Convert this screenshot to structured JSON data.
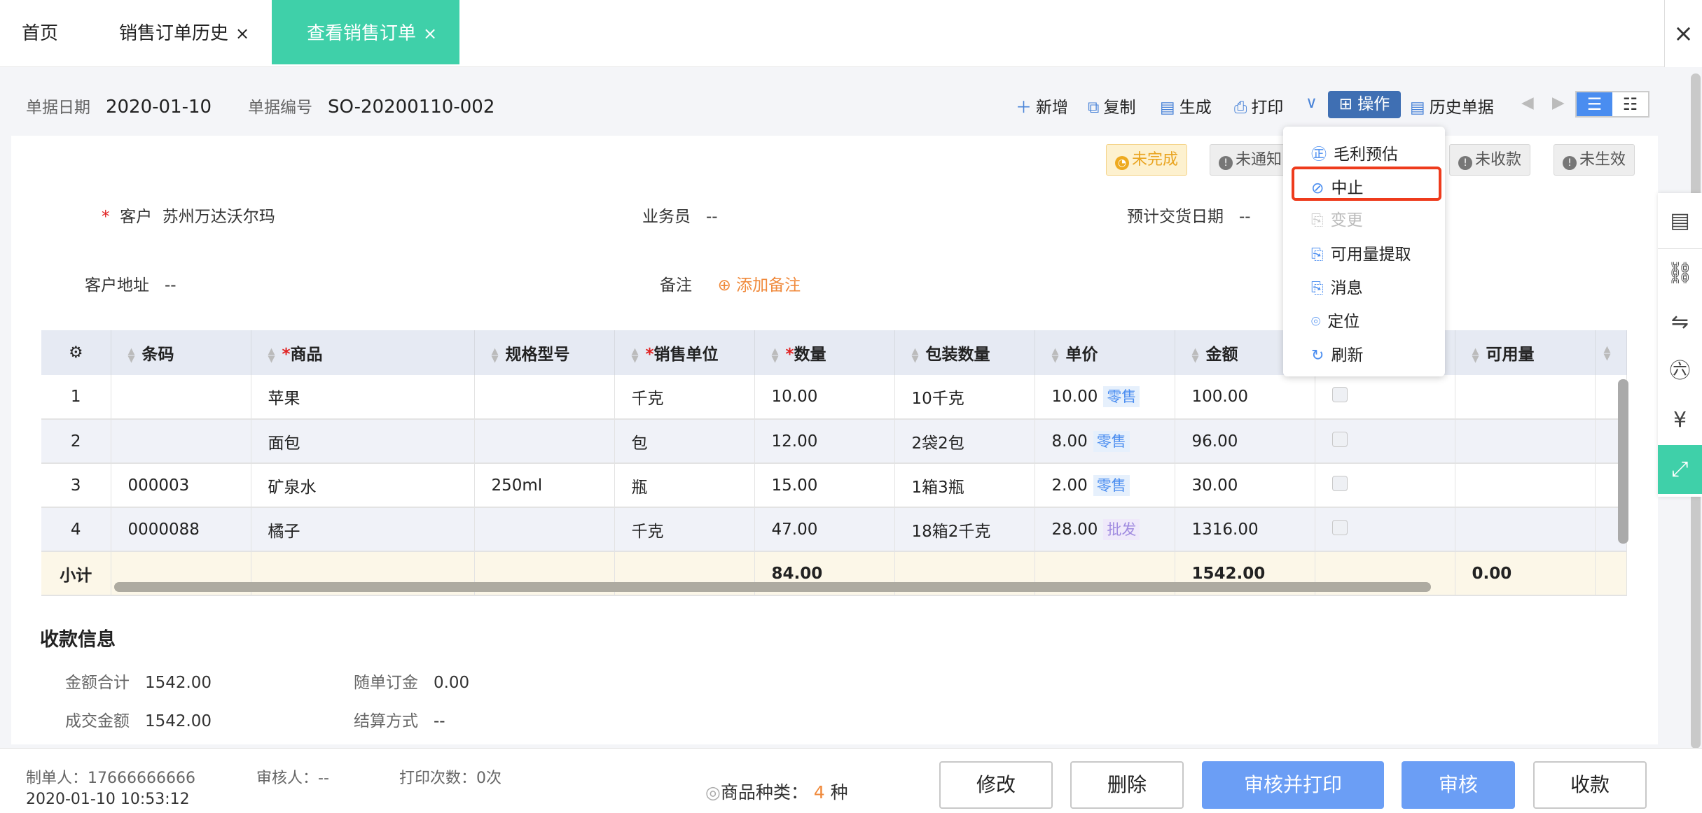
{
  "tabs": [
    {
      "label": "首页"
    },
    {
      "label": "销售订单历史",
      "close": "×"
    },
    {
      "label": "查看销售订单",
      "close": "×",
      "active": true
    }
  ],
  "tab_close_all": "×",
  "header": {
    "date_label": "单据日期",
    "date": "2020-01-10",
    "no_label": "单据编号",
    "no": "SO-20200110-002"
  },
  "toolbar": {
    "add": "新增",
    "copy": "复制",
    "generate": "生成",
    "print": "打印",
    "operate": "操作",
    "history": "历史单据"
  },
  "statuses": [
    "未完成",
    "未通知",
    "未收款",
    "未生效"
  ],
  "form": {
    "customer_label": "客户",
    "customer": "苏州万达沃尔玛",
    "salesman_label": "业务员",
    "salesman": "--",
    "delivery_label": "预计交货日期",
    "delivery": "--",
    "address_label": "客户地址",
    "address": "--",
    "remark_label": "备注",
    "add_remark": "添加备注"
  },
  "table": {
    "headers": [
      "条码",
      "商品",
      "规格型号",
      "销售单位",
      "数量",
      "包装数量",
      "单价",
      "金额",
      "",
      "可用量"
    ],
    "rows": [
      {
        "no": "1",
        "barcode": "",
        "name": "苹果",
        "spec": "",
        "unit": "千克",
        "qty": "10.00",
        "pack": "10千克",
        "price": "10.00",
        "price_type": "零售",
        "amount": "100.00"
      },
      {
        "no": "2",
        "barcode": "",
        "name": "面包",
        "spec": "",
        "unit": "包",
        "qty": "12.00",
        "pack": "2袋2包",
        "price": "8.00",
        "price_type": "零售",
        "amount": "96.00"
      },
      {
        "no": "3",
        "barcode": "000003",
        "name": "矿泉水",
        "spec": "250ml",
        "unit": "瓶",
        "qty": "15.00",
        "pack": "1箱3瓶",
        "price": "2.00",
        "price_type": "零售",
        "amount": "30.00"
      },
      {
        "no": "4",
        "barcode": "0000088",
        "name": "橘子",
        "spec": "",
        "unit": "千克",
        "qty": "47.00",
        "pack": "18箱2千克",
        "price": "28.00",
        "price_type": "批发",
        "amount": "1316.00"
      }
    ],
    "subtotal": {
      "label": "小计",
      "qty": "84.00",
      "amount": "1542.00",
      "available": "0.00"
    }
  },
  "payment": {
    "title": "收款信息",
    "total_label": "金额合计",
    "total": "1542.00",
    "deposit_label": "随单订金",
    "deposit": "0.00",
    "deal_label": "成交金额",
    "deal": "1542.00",
    "settle_label": "结算方式",
    "settle": "--"
  },
  "footer": {
    "creator": "制单人：17666666666",
    "reviewer": "审核人：--",
    "print_count": "打印次数：0次",
    "created": "2020-01-10 10:53:12",
    "kinds_label": "商品种类：",
    "kinds": "4",
    "kinds_unit": "种"
  },
  "buttons": {
    "edit": "修改",
    "delete": "删除",
    "review_print": "审核并打印",
    "review": "审核",
    "collect": "收款"
  },
  "menu": [
    "毛利预估",
    "中止",
    "变更",
    "可用量提取",
    "消息",
    "定位",
    "刷新"
  ],
  "colors": {
    "accent": "#3fd0a9",
    "primary": "#6b9ef5",
    "highlight": "#ee3b1c"
  }
}
